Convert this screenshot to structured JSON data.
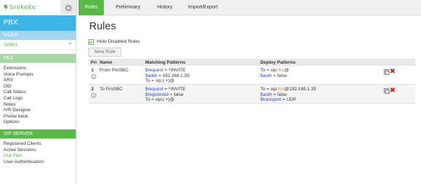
{
  "brand": {
    "name": "brekeke",
    "accent": "#58b947",
    "banner_color": "#3cb4e5"
  },
  "sidebar": {
    "app_title": "PBX",
    "user_section": "USER",
    "select_label": "Select",
    "pbx_section": "PBX",
    "pbx_items": [
      "Extensions",
      "Voice Prompts",
      "ARS",
      "DID",
      "Call Status",
      "Call Logs",
      "Notes",
      "IVR Designer",
      "Phone book",
      "Options"
    ],
    "sip_section": "SIP SERVER",
    "sip_items": [
      "Registered Clients",
      "Active Sessions",
      "Dial Plan",
      "User Authentication"
    ],
    "active_item": "Dial Plan"
  },
  "tabs": [
    {
      "label": "Rules",
      "active": true
    },
    {
      "label": "Preliminary",
      "active": false
    },
    {
      "label": "History",
      "active": false
    },
    {
      "label": "Import/Export",
      "active": false
    }
  ],
  "main": {
    "title": "Rules",
    "hide_disabled_label": "Hide Disabled Rules",
    "hide_disabled_checked": true,
    "new_rule_label": "New Rule",
    "columns": {
      "pri": "Pri",
      "name": "Name",
      "matching": "Matching Patterns",
      "deploy": "Deploy Patterns"
    },
    "rules": [
      {
        "pri": "1",
        "name": "From ProSBC",
        "matching": [
          {
            "var": "$request",
            "rest": " = ^INVITE"
          },
          {
            "var": "$addr",
            "rest": " = 192.168.1.35"
          },
          {
            "var": "",
            "rest": "To = sip:(.+)@"
          }
        ],
        "deploy": [
          {
            "var": "",
            "rest": "To = sip:",
            "param": "%1",
            "tail": "@"
          },
          {
            "var": "$auth",
            "rest": " = false",
            "param": "",
            "tail": ""
          }
        ]
      },
      {
        "pri": "2",
        "name": "To ProSBC",
        "matching": [
          {
            "var": "$request",
            "rest": " = ^INVITE"
          },
          {
            "var": "$registered",
            "rest": " = false"
          },
          {
            "var": "",
            "rest": "To = sip:(.+)@"
          }
        ],
        "deploy": [
          {
            "var": "",
            "rest": "To = sip:",
            "param": "%1",
            "tail": "@192.168.1.35"
          },
          {
            "var": "$auth",
            "rest": " = false",
            "param": "",
            "tail": ""
          },
          {
            "var": "$transport",
            "rest": " = UDP",
            "param": "",
            "tail": ""
          }
        ]
      }
    ]
  }
}
